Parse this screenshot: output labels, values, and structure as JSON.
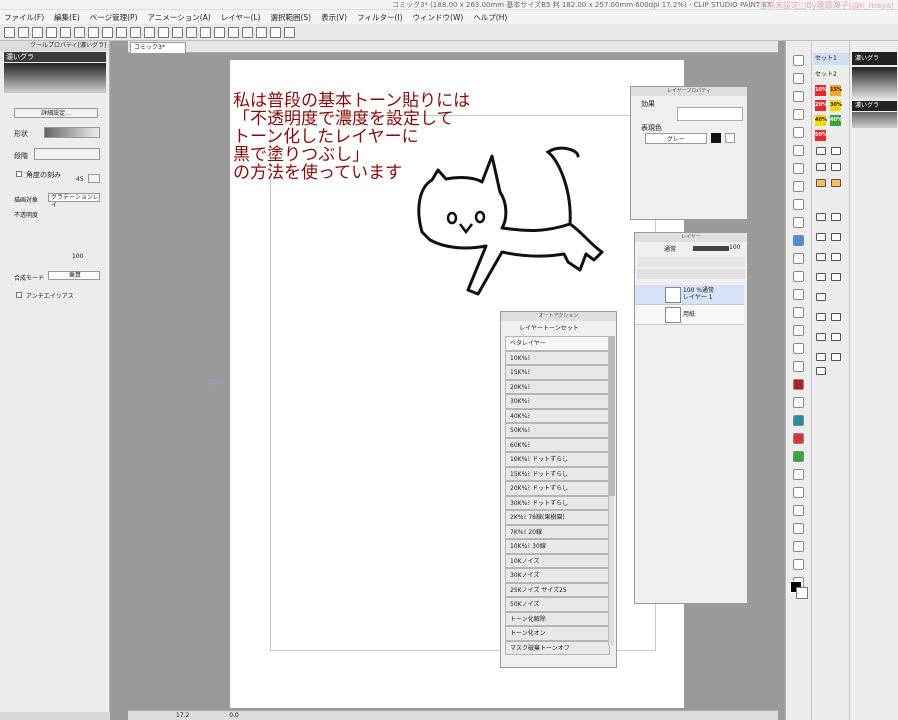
{
  "window": {
    "title": "コミック3* (188.00 x 263.00mm 基本サイズB5 判 182.00 x 257.00mm 600dpi 17.2%) - CLIP STUDIO PAINT EX",
    "watermark": "名称未設定□By雛鄒瀬子(@k_maya)"
  },
  "menu": [
    "ファイル(F)",
    "編集(E)",
    "ページ管理(P)",
    "アニメーション(A)",
    "レイヤー(L)",
    "選択範囲(S)",
    "表示(V)",
    "フィルター(I)",
    "ウィンドウ(W)",
    "ヘルプ(H)"
  ],
  "tool_property": {
    "header": "ツールプロパティ[濃いグラ]",
    "tool_name": "濃いグラ",
    "edit_button": "詳細設定...",
    "shape_label": "形状",
    "step_label": "段階",
    "angle_label": "角度の刻み",
    "angle_value": "45",
    "draw_target_label": "描画対象",
    "draw_target_value": "グラデーションレイ",
    "opacity_label": "不透明度",
    "opacity_value": "100",
    "blend_label": "合成モード",
    "blend_value": "乗算",
    "antialias_label": "アンチエイリアス"
  },
  "document_tab": "コミック3*",
  "annotation": {
    "lines": [
      "私は普段の基本トーン貼りには",
      "「不透明度で濃度を設定して",
      "トーン化したレイヤーに",
      "黒で塗りつぶし」",
      "の方法を使っています"
    ]
  },
  "layer_property": {
    "title": "レイヤープロパティ",
    "effect_label": "効果",
    "color_label": "表現色",
    "color_value": "グレー"
  },
  "layer_panel": {
    "title": "レイヤー",
    "blend_value": "通常",
    "opacity_value": "100",
    "layers": [
      {
        "line1": "100 %通常",
        "line2": "レイヤー 1"
      },
      {
        "line1": "",
        "line2": "用紙"
      }
    ]
  },
  "auto_action": {
    "title": "オートアクション",
    "set_name": "レイヤートーンセット",
    "items": [
      "ベタレイヤー",
      "10K%ﾐ",
      "15K%ﾐ",
      "20K%ﾐ",
      "30K%ﾐ",
      "40K%ﾐ",
      "50K%ﾐ",
      "60K%ﾐ",
      "10K%ﾐ ドットずらし",
      "15K%ﾐ ドットずらし",
      "20K%ﾐ ドットずらし",
      "30K%ﾐ ドットずらし",
      "2K%ﾐ 78線(果樹園)",
      "7K%ﾐ 20線",
      "10K%ﾐ 30線",
      "10Kノイズ",
      "30Kノイズ",
      "25Kノイズ サイズ25",
      "50Kノイズ",
      "トーン化解除",
      "トーン化オン",
      "マスク破棄トーンオフ"
    ]
  },
  "material_sets": {
    "items": [
      "セット1",
      "セット2"
    ]
  },
  "material_palette": {
    "top_label": "濃いグラ",
    "mid_label": "濃いグラ"
  },
  "tones": [
    {
      "label": "10%",
      "color": "#e8262b"
    },
    {
      "label": "15%",
      "color": "#f5a623"
    },
    {
      "label": "20%",
      "color": "#e8262b"
    },
    {
      "label": "30%",
      "color": "#f5d800"
    },
    {
      "label": "40%",
      "color": "#f5d800"
    },
    {
      "label": "40%",
      "color": "#3ca53a"
    },
    {
      "label": "50%",
      "color": "#e8262b"
    }
  ],
  "status": {
    "zoom": "17.2",
    "angle": "0.0"
  }
}
